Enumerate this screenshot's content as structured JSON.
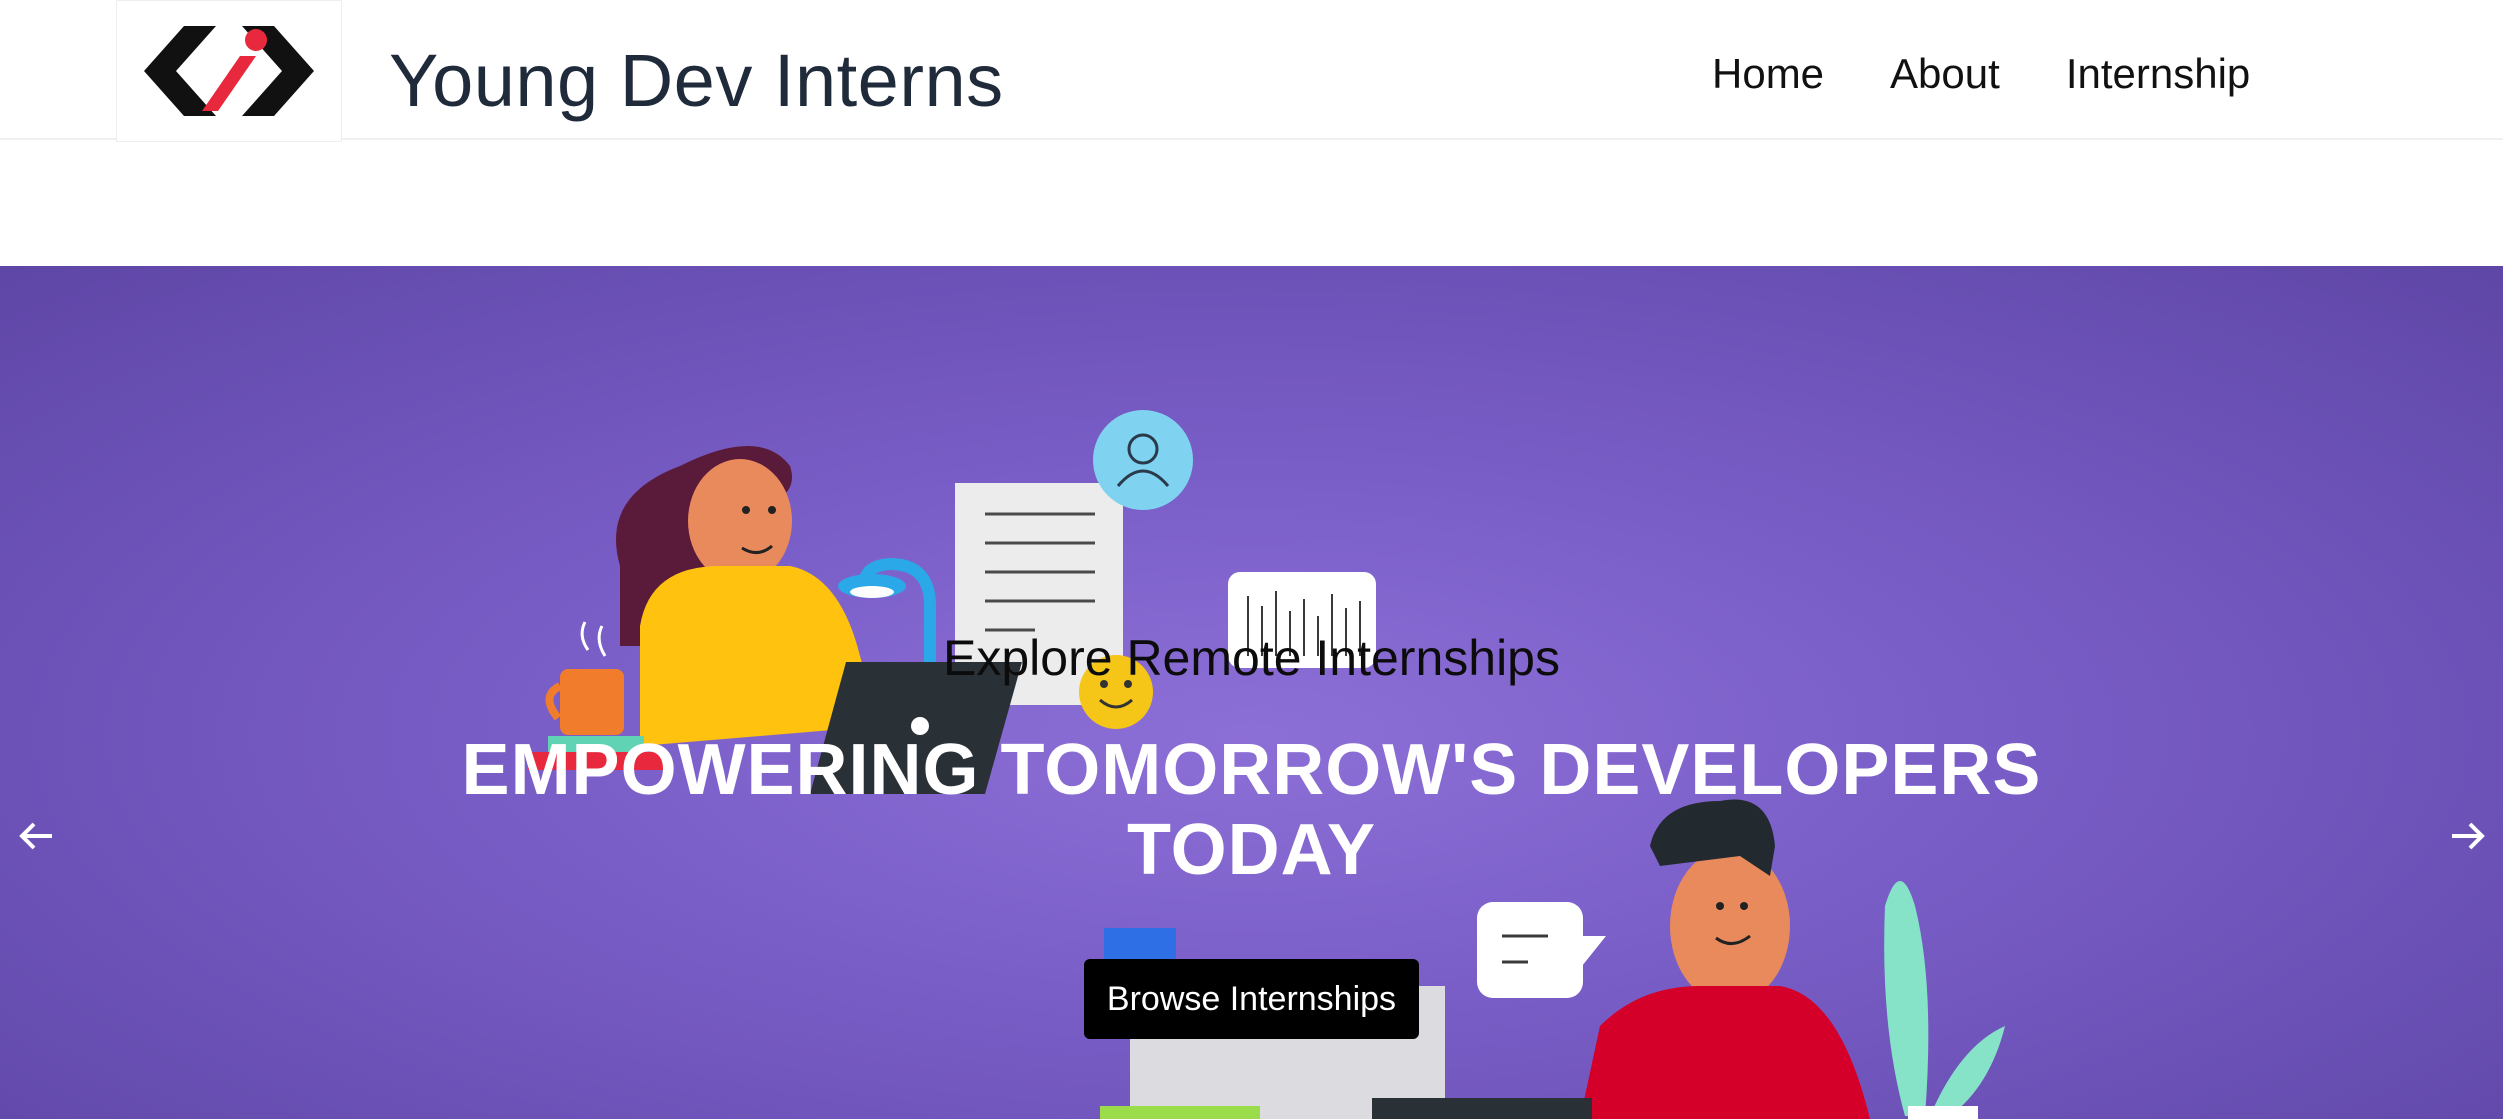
{
  "header": {
    "logo_icon": "brand-logo-icon",
    "title": "Young Dev Interns",
    "nav": [
      {
        "label": "Home"
      },
      {
        "label": "About"
      },
      {
        "label": "Internship"
      }
    ]
  },
  "hero": {
    "subtitle": "Explore Remote Internships",
    "title_line1": "EMPOWERING TOMORROW'S DEVELOPERS",
    "title_line2": "TODAY",
    "cta_label": "Browse Internships",
    "prev_icon": "arrow-left-icon",
    "next_icon": "arrow-right-icon"
  },
  "colors": {
    "hero_bg": "#7a5ec8",
    "logo_red": "#e8283c",
    "logo_black": "#111111",
    "cta_bg": "#000000"
  }
}
